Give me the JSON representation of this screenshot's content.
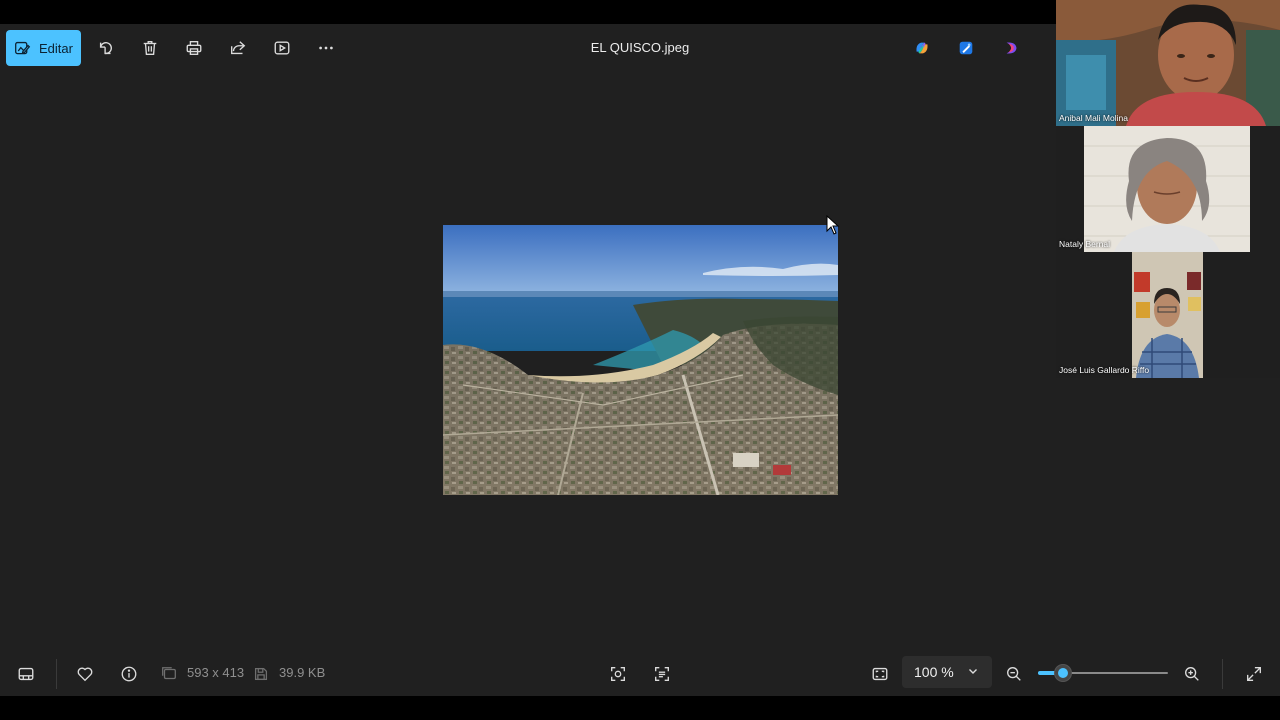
{
  "app": {
    "file_title": "EL QUISCO.jpeg",
    "edit_label": "Editar"
  },
  "toolbar": {
    "icons": [
      "rotate-icon",
      "delete-icon",
      "print-icon",
      "share-icon",
      "slideshow-icon",
      "more-icon"
    ],
    "right_icons": [
      "copilot-icon",
      "designer-icon",
      "clipchamp-icon"
    ]
  },
  "image": {
    "alt": "EL QUISCO aerial view"
  },
  "status": {
    "dimensions": "593 x 413",
    "file_size": "39.9 KB",
    "zoom_value": "100 %",
    "zoom_level_fraction": 0.19
  },
  "participants": [
    {
      "name": "Anibal Mali Molina"
    },
    {
      "name": "Nataly Bernal"
    },
    {
      "name": "José Luis Gallardo Riffo"
    }
  ],
  "colors": {
    "accent": "#4cc2ff",
    "app_bg": "#202020"
  }
}
